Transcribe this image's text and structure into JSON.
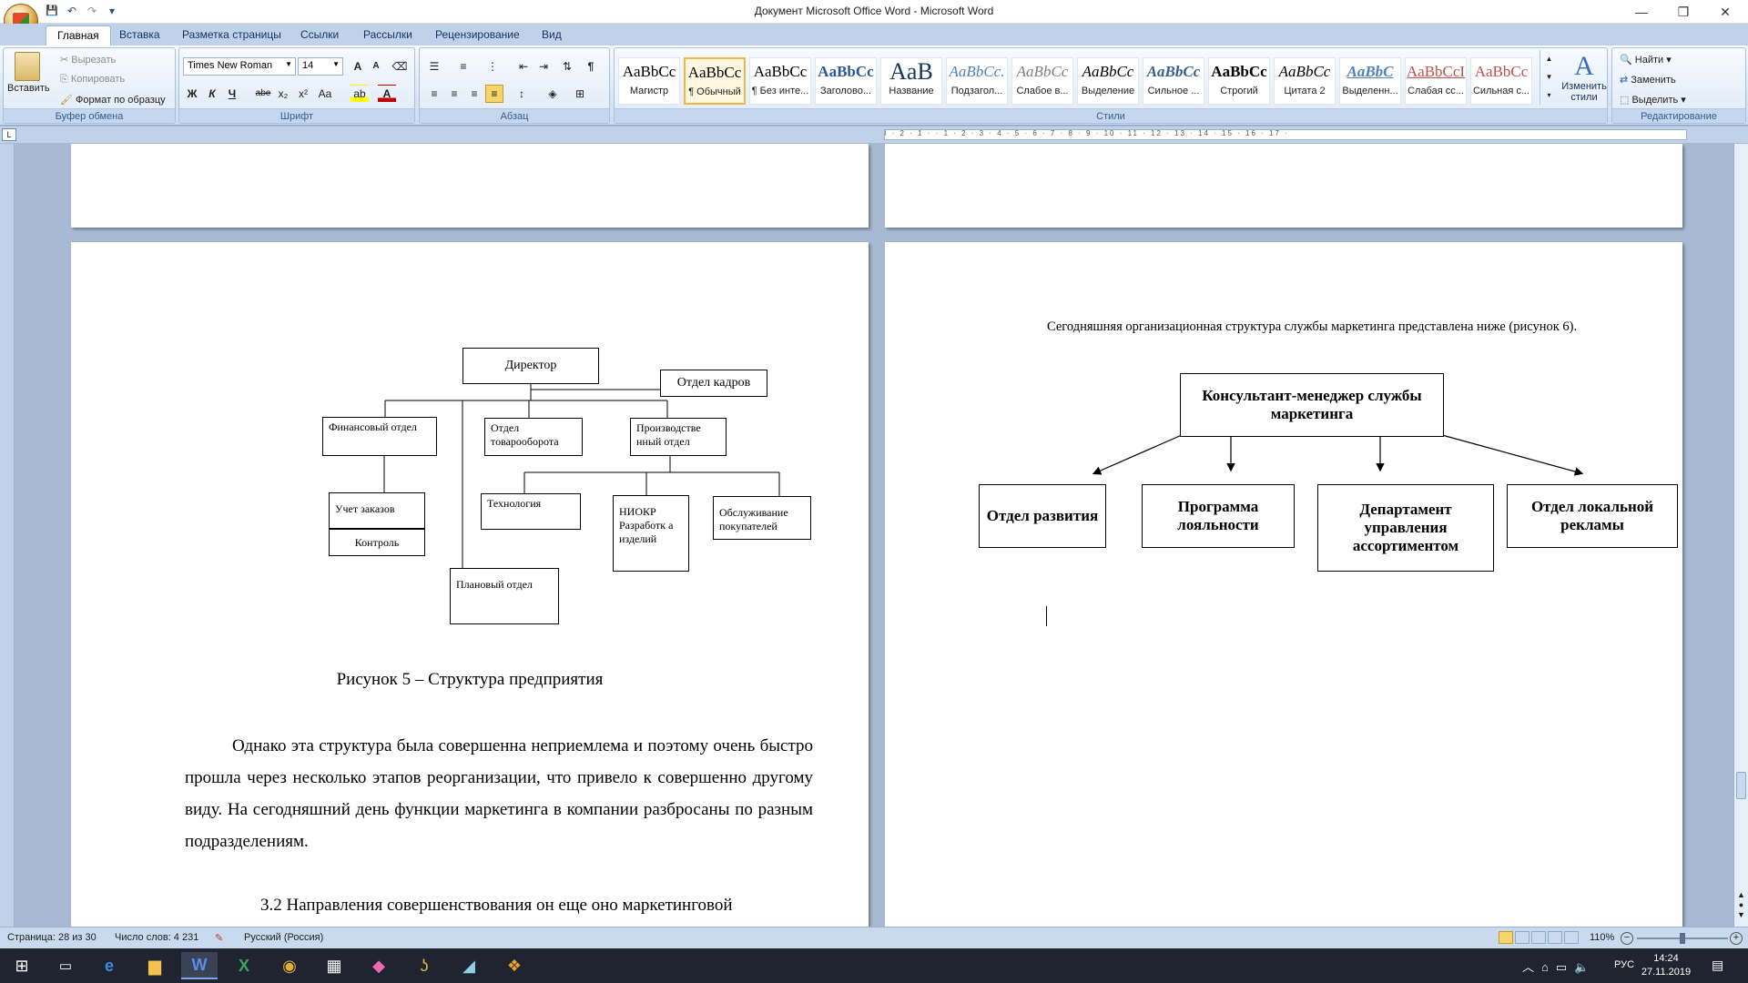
{
  "window": {
    "title": "Документ Microsoft Office Word - Microsoft Word",
    "minimize": "—",
    "restore": "❐",
    "close": "✕"
  },
  "qat": {
    "save": "💾",
    "undo": "↶",
    "redo": "↷",
    "customize": "▾"
  },
  "tabs": [
    "Главная",
    "Вставка",
    "Разметка страницы",
    "Ссылки",
    "Рассылки",
    "Рецензирование",
    "Вид"
  ],
  "ribbon": {
    "clipboard": {
      "label": "Буфер обмена",
      "paste": "Вставить",
      "cut": "Вырезать",
      "copy": "Копировать",
      "format_painter": "Формат по образцу"
    },
    "font": {
      "label": "Шрифт",
      "family": "Times New Roman",
      "size": "14",
      "bold": "Ж",
      "italic": "К",
      "underline": "Ч",
      "strike": "abe",
      "sub": "x₂",
      "sup": "x²",
      "case": "Aa",
      "grow": "A",
      "shrink": "A",
      "color": "A"
    },
    "paragraph": {
      "label": "Абзац",
      "pilcrow": "¶"
    },
    "styles": {
      "label": "Стили",
      "change_styles": "Изменить стили",
      "items": [
        {
          "sample": "AaBbCc",
          "name": "Магистр"
        },
        {
          "sample": "AaBbCc",
          "name": "¶ Обычный"
        },
        {
          "sample": "AaBbCc",
          "name": "¶ Без инте..."
        },
        {
          "sample": "AaBbCc",
          "name": "Заголово..."
        },
        {
          "sample": "AaB",
          "name": "Название"
        },
        {
          "sample": "AaBbCc.",
          "name": "Подзагол..."
        },
        {
          "sample": "AaBbCc",
          "name": "Слабое в..."
        },
        {
          "sample": "AaBbCc",
          "name": "Выделение"
        },
        {
          "sample": "AaBbCc",
          "name": "Сильное ..."
        },
        {
          "sample": "AaBbCc",
          "name": "Строгий"
        },
        {
          "sample": "AaBbCc",
          "name": "Цитата 2"
        },
        {
          "sample": "AaBbC",
          "name": "Выделенн..."
        },
        {
          "sample": "AaBbCcI",
          "name": "Слабая сс..."
        },
        {
          "sample": "AaBbCc",
          "name": "Сильная с..."
        }
      ]
    },
    "editing": {
      "label": "Редактирование",
      "find": "Найти",
      "replace": "Заменить",
      "select": "Выделить"
    }
  },
  "ruler": {
    "marks": "3 · 2 · 1 · · 1 · 2 · 3 · 4 · 5 · 6 · 7 · 8 · 9 · 10 · 11 · 12 · 13 · 14 · 15 · 16 · 17 ·"
  },
  "left_page": {
    "chart": {
      "director": "Директор",
      "hr": "Отдел кадров",
      "finance": "Финансовый отдел",
      "trade": "Отдел товарооборота",
      "production": "Производстве нный отдел",
      "orders": "Учет заказов",
      "control": "Контроль",
      "tech": "Технология",
      "niokr": "НИОКР Разработк а изделий",
      "service": "Обслуживание покупателей",
      "planning": "Плановый отдел"
    },
    "caption": "Рисунок 5 – Структура предприятия",
    "paragraph": "Однако эта структура была совершенна неприемлема и поэтому очень быстро прошла через несколько этапов реорганизации, что привело к совершенно другому виду. На сегодняшний день функции маркетинга в компании разбросаны по разным подразделениям.",
    "heading": "3.2 Направления совершенствования он еще оно маркетинговой"
  },
  "right_page": {
    "intro": "Сегодняшняя организационная структура службы маркетинга представлена ниже (рисунок 6).",
    "chart": {
      "top": "Консультант-менеджер службы маркетинга",
      "dev": "Отдел развития",
      "loyalty": "Программа лояльности",
      "assortment": "Департамент управления ассортиментом",
      "ads": "Отдел локальной рекламы"
    }
  },
  "status": {
    "page": "Страница: 28 из 30",
    "words": "Число слов: 4 231",
    "lang": "Русский (Россия)",
    "zoom": "110%"
  },
  "taskbar": {
    "lang": "РУС",
    "time": "14:24",
    "date": "27.11.2019"
  }
}
